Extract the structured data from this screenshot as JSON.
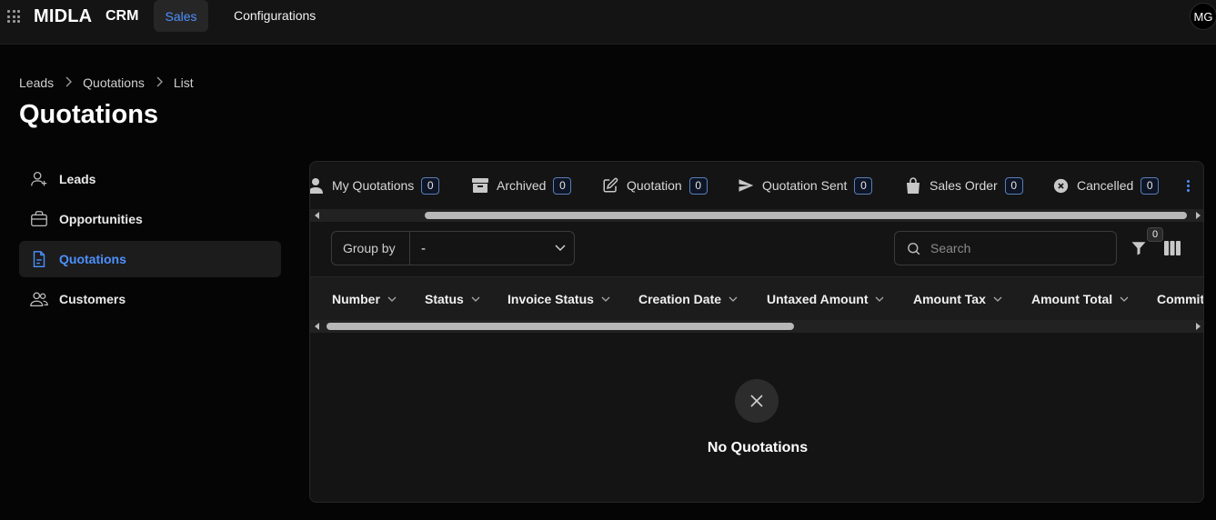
{
  "topbar": {
    "brand": "MIDLA",
    "brand_sub": "CRM",
    "nav": [
      "Sales",
      "Configurations"
    ],
    "avatar": "MG"
  },
  "breadcrumb": [
    "Leads",
    "Quotations",
    "List"
  ],
  "page_title": "Quotations",
  "sidebar": {
    "items": [
      {
        "label": "Leads",
        "icon": "user-plus-icon"
      },
      {
        "label": "Opportunities",
        "icon": "briefcase-icon"
      },
      {
        "label": "Quotations",
        "icon": "document-icon",
        "active": true
      },
      {
        "label": "Customers",
        "icon": "users-icon"
      }
    ]
  },
  "tabs": [
    {
      "label": "My Quotations",
      "count": "0",
      "icon": "user-icon"
    },
    {
      "label": "Archived",
      "count": "0",
      "icon": "archive-icon"
    },
    {
      "label": "Quotation",
      "count": "0",
      "icon": "edit-icon"
    },
    {
      "label": "Quotation Sent",
      "count": "0",
      "icon": "send-icon"
    },
    {
      "label": "Sales Order",
      "count": "0",
      "icon": "shopping-bag-icon"
    },
    {
      "label": "Cancelled",
      "count": "0",
      "icon": "cancel-icon"
    }
  ],
  "toolbar": {
    "group_by_label": "Group by",
    "group_by_value": "-",
    "search_placeholder": "Search",
    "filter_count": "0"
  },
  "columns": [
    "Number",
    "Status",
    "Invoice Status",
    "Creation Date",
    "Untaxed Amount",
    "Amount Tax",
    "Amount Total",
    "Commit"
  ],
  "empty_state": {
    "message": "No Quotations"
  },
  "colors": {
    "accent": "#4d90fe",
    "background": "#050505",
    "panel": "#141414"
  }
}
